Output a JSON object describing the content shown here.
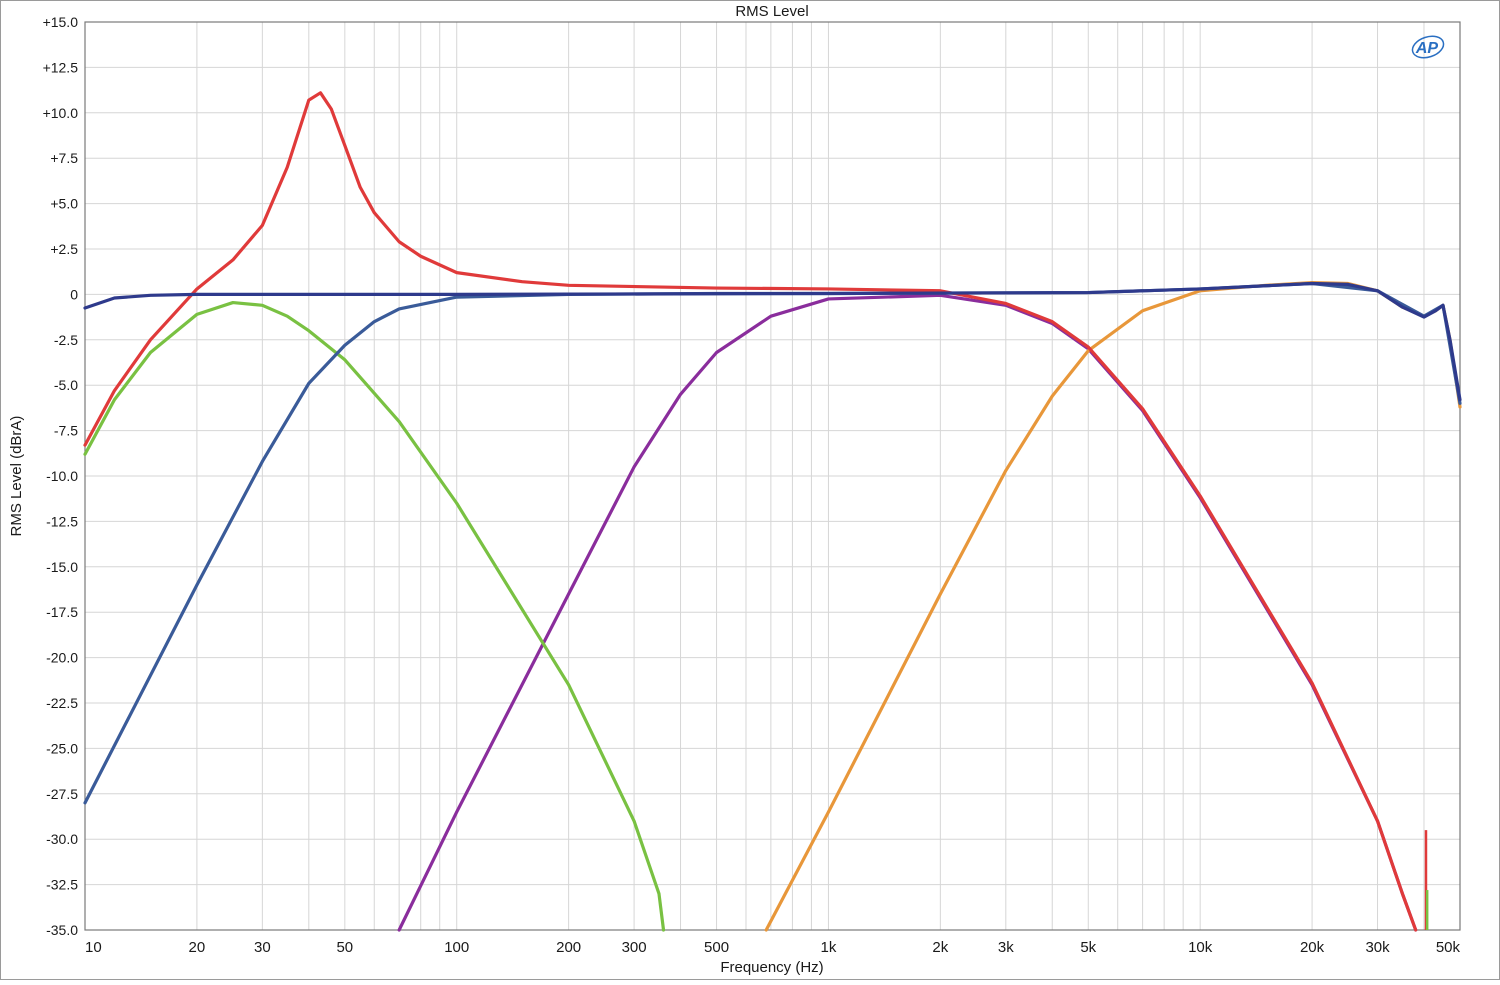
{
  "chart_data": {
    "type": "line",
    "title": "RMS Level",
    "xlabel": "Frequency (Hz)",
    "ylabel": "RMS Level (dBrA)",
    "xscale": "log",
    "xlim": [
      10,
      50000
    ],
    "ylim": [
      -35,
      15
    ],
    "grid": true,
    "logo_text": "AP",
    "x_ticks": [
      {
        "value": 10,
        "label": "10"
      },
      {
        "value": 20,
        "label": "20"
      },
      {
        "value": 30,
        "label": "30"
      },
      {
        "value": 50,
        "label": "50"
      },
      {
        "value": 100,
        "label": "100"
      },
      {
        "value": 200,
        "label": "200"
      },
      {
        "value": 300,
        "label": "300"
      },
      {
        "value": 500,
        "label": "500"
      },
      {
        "value": 1000,
        "label": "1k"
      },
      {
        "value": 2000,
        "label": "2k"
      },
      {
        "value": 3000,
        "label": "3k"
      },
      {
        "value": 5000,
        "label": "5k"
      },
      {
        "value": 10000,
        "label": "10k"
      },
      {
        "value": 20000,
        "label": "20k"
      },
      {
        "value": 30000,
        "label": "30k"
      },
      {
        "value": 50000,
        "label": "50k"
      }
    ],
    "y_ticks": [
      {
        "value": 15,
        "label": "+15.0"
      },
      {
        "value": 12.5,
        "label": "+12.5"
      },
      {
        "value": 10,
        "label": "+10.0"
      },
      {
        "value": 7.5,
        "label": "+7.5"
      },
      {
        "value": 5,
        "label": "+5.0"
      },
      {
        "value": 2.5,
        "label": "+2.5"
      },
      {
        "value": 0,
        "label": "0"
      },
      {
        "value": -2.5,
        "label": "-2.5"
      },
      {
        "value": -5,
        "label": "-5.0"
      },
      {
        "value": -7.5,
        "label": "-7.5"
      },
      {
        "value": -10,
        "label": "-10.0"
      },
      {
        "value": -12.5,
        "label": "-12.5"
      },
      {
        "value": -15,
        "label": "-15.0"
      },
      {
        "value": -17.5,
        "label": "-17.5"
      },
      {
        "value": -20,
        "label": "-20.0"
      },
      {
        "value": -22.5,
        "label": "-22.5"
      },
      {
        "value": -25,
        "label": "-25.0"
      },
      {
        "value": -27.5,
        "label": "-27.5"
      },
      {
        "value": -30,
        "label": "-30.0"
      },
      {
        "value": -32.5,
        "label": "-32.5"
      },
      {
        "value": -35,
        "label": "-35.0"
      }
    ],
    "series": [
      {
        "color": "#8a2d9c",
        "points": [
          [
            70,
            -35
          ],
          [
            100,
            -28.5
          ],
          [
            200,
            -16.5
          ],
          [
            300,
            -9.5
          ],
          [
            400,
            -5.5
          ],
          [
            500,
            -3.2
          ],
          [
            700,
            -1.2
          ],
          [
            1000,
            -0.25
          ],
          [
            2000,
            -0.05
          ],
          [
            3000,
            -0.6
          ],
          [
            4000,
            -1.6
          ],
          [
            5000,
            -3.0
          ],
          [
            7000,
            -6.4
          ],
          [
            10000,
            -11.2
          ],
          [
            20000,
            -21.5
          ],
          [
            30000,
            -29
          ],
          [
            35000,
            -33
          ],
          [
            38000,
            -35
          ]
        ]
      },
      {
        "color": "#e8973a",
        "points": [
          [
            680,
            -35
          ],
          [
            1000,
            -28.5
          ],
          [
            2000,
            -16.5
          ],
          [
            3000,
            -9.7
          ],
          [
            4000,
            -5.6
          ],
          [
            5000,
            -3.1
          ],
          [
            7000,
            -0.9
          ],
          [
            10000,
            0.2
          ],
          [
            15000,
            0.5
          ],
          [
            20000,
            0.65
          ],
          [
            25000,
            0.6
          ],
          [
            30000,
            0.2
          ],
          [
            35000,
            -0.7
          ],
          [
            40000,
            -1.2
          ],
          [
            43000,
            -0.9
          ],
          [
            45000,
            -0.6
          ],
          [
            47000,
            -2.5
          ],
          [
            50000,
            -6.2
          ]
        ]
      },
      {
        "color": "#79c142",
        "points": [
          [
            10,
            -8.8
          ],
          [
            12,
            -5.8
          ],
          [
            15,
            -3.2
          ],
          [
            20,
            -1.1
          ],
          [
            25,
            -0.45
          ],
          [
            30,
            -0.6
          ],
          [
            35,
            -1.2
          ],
          [
            40,
            -2.0
          ],
          [
            50,
            -3.6
          ],
          [
            70,
            -7.0
          ],
          [
            100,
            -11.5
          ],
          [
            200,
            -21.5
          ],
          [
            300,
            -29
          ],
          [
            350,
            -33
          ],
          [
            360,
            -35
          ]
        ]
      },
      {
        "color": "#3a5b99",
        "points": [
          [
            10,
            -28
          ],
          [
            20,
            -16
          ],
          [
            30,
            -9.2
          ],
          [
            40,
            -4.9
          ],
          [
            50,
            -2.8
          ],
          [
            60,
            -1.5
          ],
          [
            70,
            -0.8
          ],
          [
            100,
            -0.15
          ],
          [
            200,
            0
          ],
          [
            500,
            0.05
          ],
          [
            1000,
            0.05
          ],
          [
            5000,
            0.1
          ],
          [
            10000,
            0.3
          ],
          [
            20000,
            0.6
          ],
          [
            30000,
            0.2
          ],
          [
            40000,
            -1.2
          ],
          [
            45000,
            -0.6
          ],
          [
            50000,
            -6.0
          ]
        ]
      },
      {
        "color": "#e03a3a",
        "points": [
          [
            10,
            -8.3
          ],
          [
            12,
            -5.3
          ],
          [
            15,
            -2.5
          ],
          [
            20,
            0.3
          ],
          [
            25,
            1.9
          ],
          [
            30,
            3.8
          ],
          [
            35,
            7.0
          ],
          [
            40,
            10.7
          ],
          [
            43,
            11.1
          ],
          [
            46,
            10.2
          ],
          [
            50,
            8.2
          ],
          [
            55,
            5.9
          ],
          [
            60,
            4.5
          ],
          [
            70,
            2.9
          ],
          [
            80,
            2.1
          ],
          [
            100,
            1.2
          ],
          [
            150,
            0.7
          ],
          [
            200,
            0.5
          ],
          [
            500,
            0.35
          ],
          [
            1000,
            0.3
          ],
          [
            2000,
            0.2
          ],
          [
            3000,
            -0.5
          ],
          [
            4000,
            -1.5
          ],
          [
            5000,
            -2.9
          ],
          [
            7000,
            -6.3
          ],
          [
            10000,
            -11.1
          ],
          [
            20000,
            -21.4
          ],
          [
            30000,
            -29
          ],
          [
            35000,
            -33
          ],
          [
            38000,
            -35
          ]
        ]
      },
      {
        "color": "#2e3a8c",
        "points": [
          [
            10,
            -0.75
          ],
          [
            12,
            -0.2
          ],
          [
            15,
            -0.05
          ],
          [
            20,
            0
          ],
          [
            100,
            0
          ],
          [
            1000,
            0.05
          ],
          [
            5000,
            0.1
          ],
          [
            10000,
            0.3
          ],
          [
            20000,
            0.6
          ],
          [
            25000,
            0.55
          ],
          [
            30000,
            0.2
          ],
          [
            35000,
            -0.7
          ],
          [
            40000,
            -1.25
          ],
          [
            43000,
            -0.9
          ],
          [
            45000,
            -0.6
          ],
          [
            47000,
            -2.5
          ],
          [
            50000,
            -5.8
          ]
        ]
      }
    ],
    "spikes": [
      {
        "x": 40500,
        "y": -29.5,
        "color": "#e03a3a"
      },
      {
        "x": 40800,
        "y": -32.8,
        "color": "#79c142"
      }
    ]
  }
}
